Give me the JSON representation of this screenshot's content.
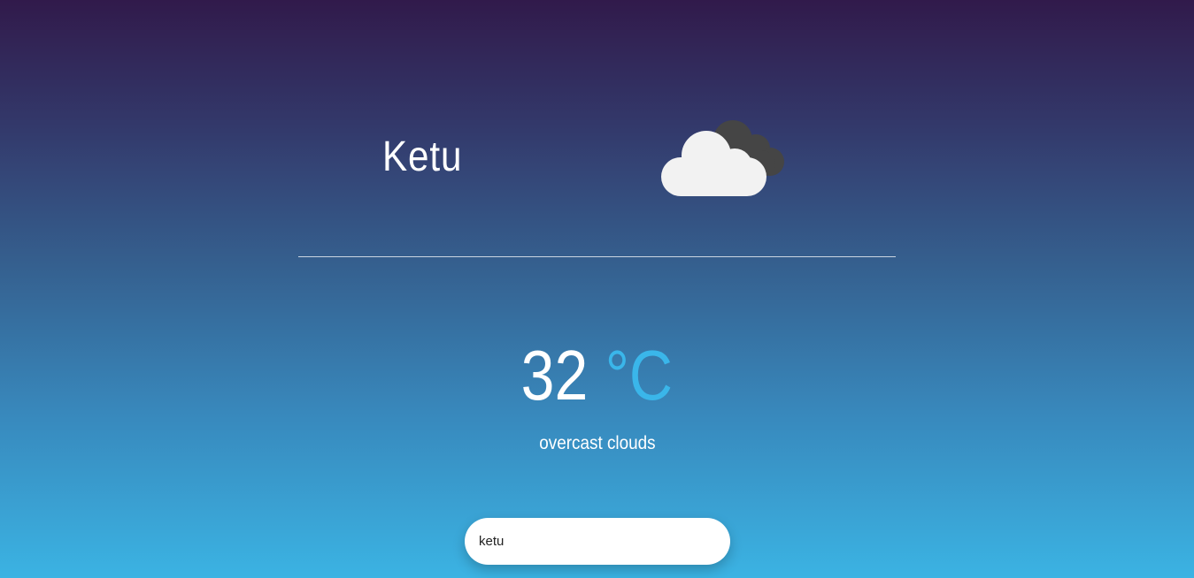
{
  "weather": {
    "city": "Ketu",
    "temperature": "32",
    "unit": "°C",
    "description": "overcast clouds",
    "icon": "overcast-clouds-icon"
  },
  "search": {
    "value": "ketu",
    "placeholder": ""
  },
  "colors": {
    "gradient_top": "#311a4b",
    "gradient_bottom": "#3bb3e3",
    "unit_accent": "#3ab6ea",
    "cloud_front": "#f2f2f2",
    "cloud_back": "#454545"
  }
}
